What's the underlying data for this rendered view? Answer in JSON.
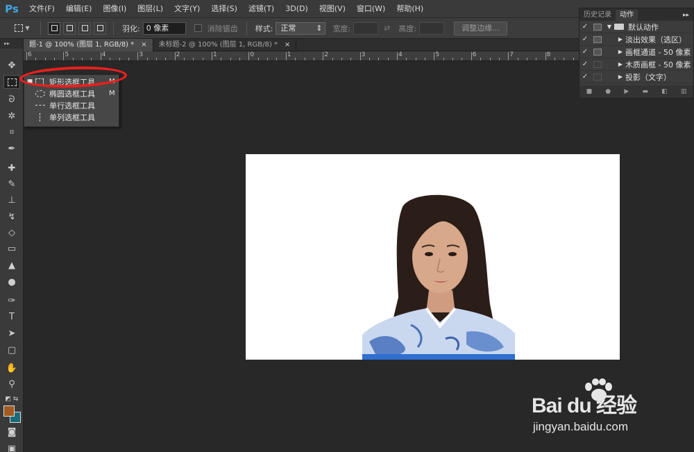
{
  "app": {
    "logo": "Ps"
  },
  "menu": [
    "文件(F)",
    "编辑(E)",
    "图像(I)",
    "图层(L)",
    "文字(Y)",
    "选择(S)",
    "滤镜(T)",
    "3D(D)",
    "视图(V)",
    "窗口(W)",
    "帮助(H)"
  ],
  "options": {
    "feather_label": "羽化:",
    "feather_value": "0 像素",
    "antialias_label": "消除锯齿",
    "style_label": "样式:",
    "style_value": "正常",
    "width_label": "宽度:",
    "height_label": "高度:",
    "refine_edge": "调整边缘..."
  },
  "tabs": [
    {
      "label": "题-1 @ 100% (图层 1, RGB/8) *",
      "close": "×",
      "active": true
    },
    {
      "label": "未标题-2 @ 100% (图层 1, RGB/8) *",
      "close": "×",
      "active": false
    }
  ],
  "ruler": {
    "numbers": [
      "6",
      "5",
      "4",
      "3",
      "2",
      "1",
      "0",
      "1",
      "2",
      "3",
      "4",
      "5",
      "6",
      "7",
      "8",
      "9"
    ]
  },
  "flyout": {
    "items": [
      {
        "label": "矩形选框工具",
        "key": "M",
        "icon": "rect-marquee-icon",
        "current": true
      },
      {
        "label": "椭圆选框工具",
        "key": "M",
        "icon": "ellipse-marquee-icon",
        "current": false
      },
      {
        "label": "单行选框工具",
        "key": "",
        "icon": "single-row-marquee-icon",
        "current": false
      },
      {
        "label": "单列选框工具",
        "key": "",
        "icon": "single-column-marquee-icon",
        "current": false
      }
    ]
  },
  "panel": {
    "tabs": [
      "历史记录",
      "动作"
    ],
    "actions": [
      {
        "label": "默认动作",
        "checked": true,
        "type": "folder"
      },
      {
        "label": "淡出效果（选区）",
        "checked": true,
        "type": "action"
      },
      {
        "label": "画框通道 - 50 像素",
        "checked": true,
        "type": "action"
      },
      {
        "label": "木质画框 - 50 像素",
        "checked": true,
        "type": "action"
      },
      {
        "label": "投影（文字）",
        "checked": true,
        "type": "action"
      }
    ]
  },
  "colors": {
    "foreground": "#a15a1f",
    "background": "#1b6a78",
    "annotation": "#e8201c"
  },
  "watermark": {
    "brand": "Bai du 经验",
    "url": "jingyan.baidu.com"
  }
}
